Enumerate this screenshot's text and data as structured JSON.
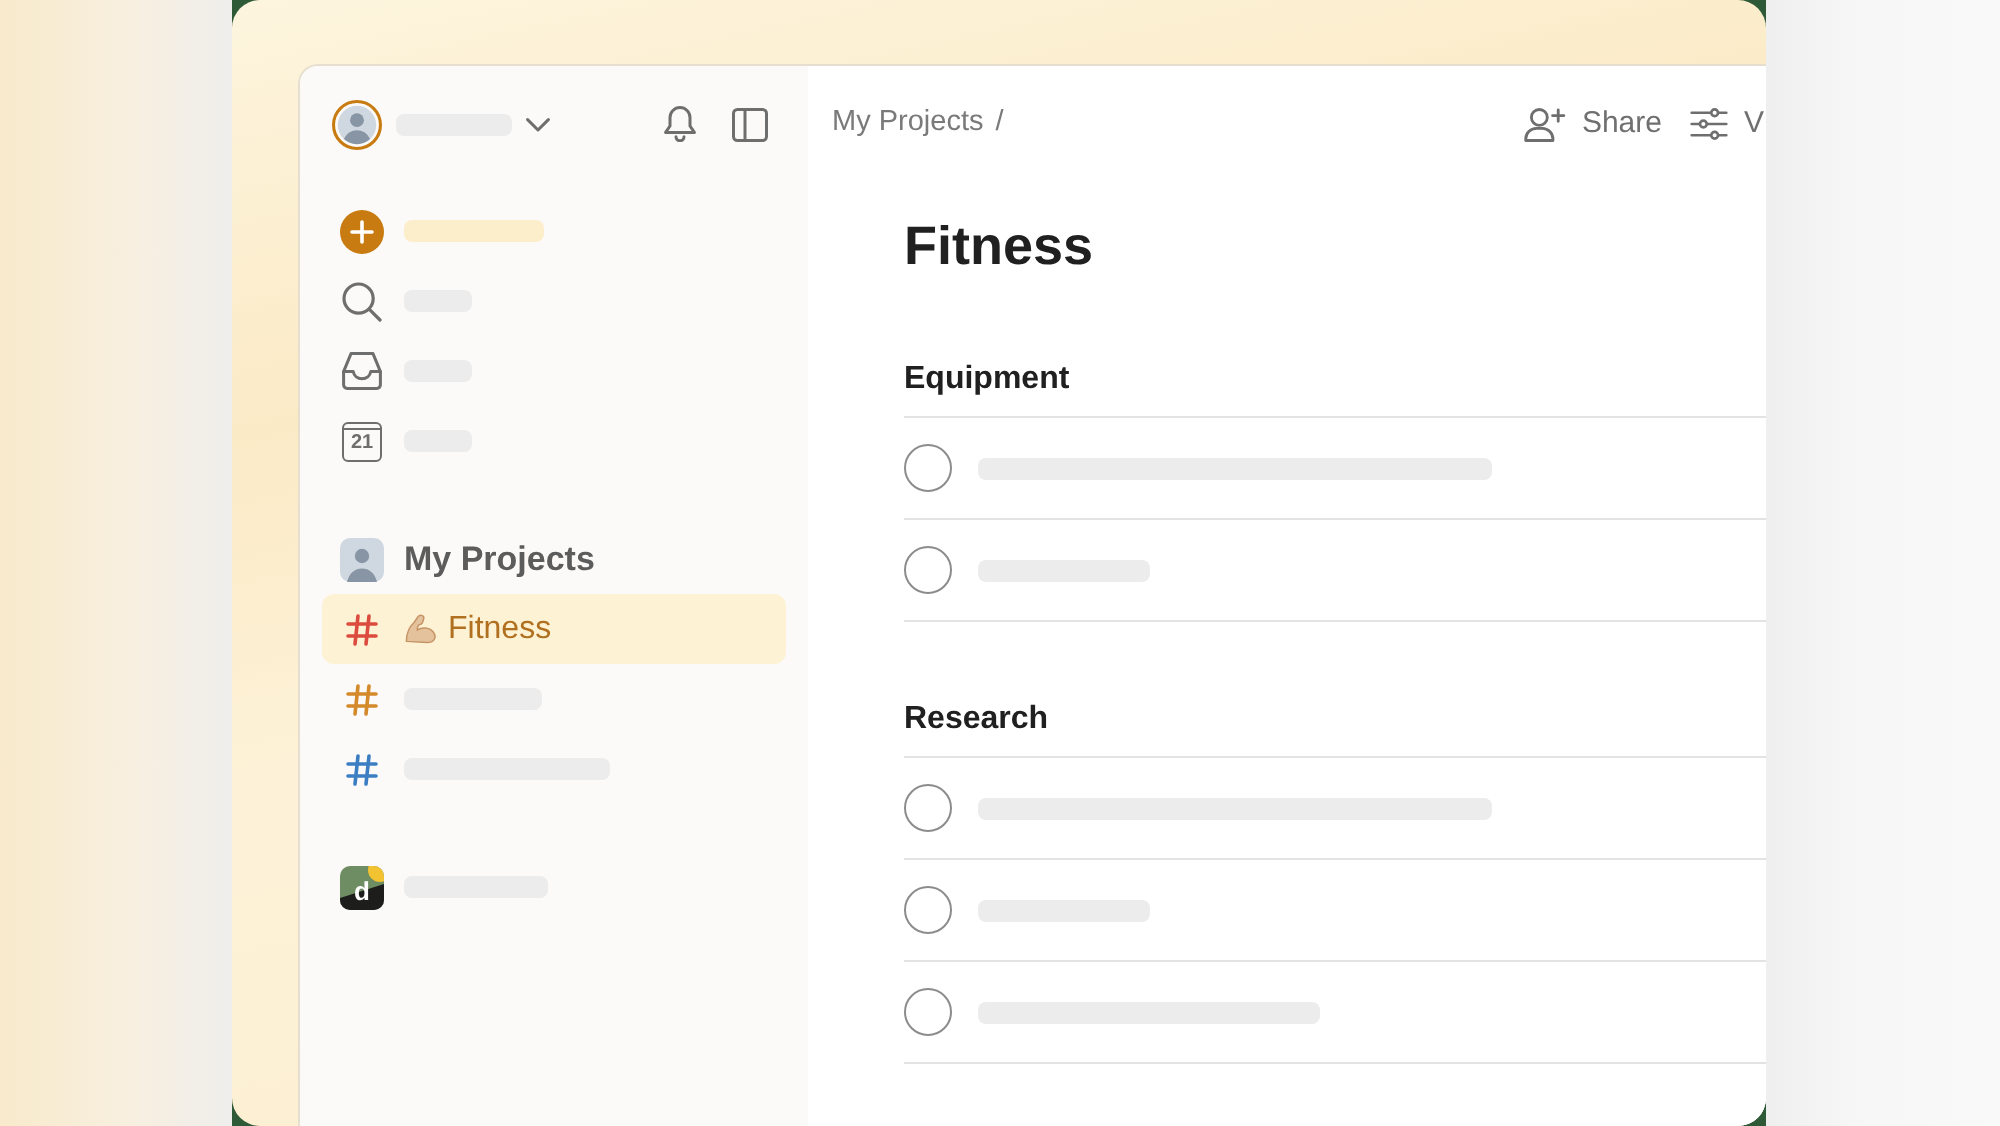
{
  "sidebar": {
    "nav": [
      {
        "kind": "add"
      },
      {
        "kind": "search"
      },
      {
        "kind": "inbox"
      },
      {
        "kind": "calendar",
        "day": "21"
      }
    ],
    "projects": {
      "title": "My Projects",
      "items": [
        {
          "label": "Fitness",
          "emoji": true,
          "selected": true,
          "color": "#dc4c3e"
        },
        {
          "emoji": false,
          "selected": false,
          "color": "#d4892a"
        },
        {
          "emoji": false,
          "selected": false,
          "color": "#3b7fc2"
        }
      ]
    },
    "workspace": {
      "logo_letter": "d"
    }
  },
  "main": {
    "breadcrumb": {
      "items": [
        "My Projects"
      ],
      "separator": "/"
    },
    "actions": [
      {
        "kind": "share",
        "label": "Share"
      },
      {
        "kind": "view",
        "label": "V"
      }
    ],
    "title": "Fitness",
    "sections": [
      {
        "title": "Equipment",
        "tasks": [
          {
            "checked": false
          },
          {
            "checked": false
          }
        ]
      },
      {
        "title": "Research",
        "tasks": [
          {
            "checked": false
          },
          {
            "checked": false
          },
          {
            "checked": false
          }
        ]
      }
    ]
  }
}
